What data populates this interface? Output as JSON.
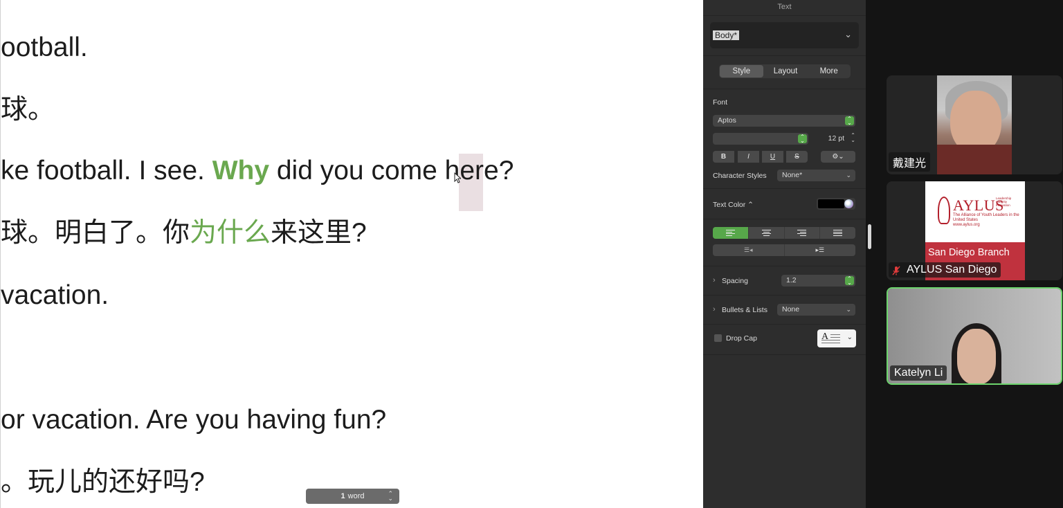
{
  "document": {
    "lines": [
      {
        "segments": [
          {
            "text": "ootball.",
            "style": "normal"
          }
        ]
      },
      {
        "segments": [
          {
            "text": "球。",
            "style": "normal"
          }
        ]
      },
      {
        "segments": [
          {
            "text": "ke football. I see. ",
            "style": "normal"
          },
          {
            "text": "Why",
            "style": "highlight-bold"
          },
          {
            "text": " did you come here?",
            "style": "normal"
          }
        ]
      },
      {
        "segments": [
          {
            "text": "球。明白了。你",
            "style": "normal"
          },
          {
            "text": "为什么",
            "style": "highlight"
          },
          {
            "text": "来这里?",
            "style": "normal"
          }
        ]
      },
      {
        "segments": [
          {
            "text": "vacation.",
            "style": "normal"
          }
        ]
      },
      {
        "segments": [
          {
            "text": "or vacation. Are you having fun?",
            "style": "normal"
          }
        ]
      },
      {
        "segments": [
          {
            "text": "。玩儿的还好吗?",
            "style": "normal"
          }
        ]
      }
    ],
    "highlight_color": "#6aa84f",
    "word_count": {
      "number": "1",
      "unit": "word"
    }
  },
  "inspector": {
    "title": "Text",
    "paragraph_style": "Body*",
    "tabs": [
      {
        "label": "Style",
        "active": true
      },
      {
        "label": "Layout",
        "active": false
      },
      {
        "label": "More",
        "active": false
      }
    ],
    "font_section_label": "Font",
    "font_name": "Aptos",
    "font_typeface": "",
    "font_size": "12 pt",
    "format_buttons": [
      "B",
      "I",
      "U",
      "S"
    ],
    "character_styles_label": "Character Styles",
    "character_styles_value": "None*",
    "text_color_label": "Text Color ⌃",
    "text_color": "#000000",
    "alignment_active": "left",
    "spacing_label": "Spacing",
    "spacing_value": "1.2",
    "bullets_label": "Bullets & Lists",
    "bullets_value": "None",
    "drop_cap_label": "Drop Cap",
    "accent_color": "#57a84a"
  },
  "participants": [
    {
      "name": "戴建光",
      "muted": false,
      "speaking": false
    },
    {
      "name": "AYLUS San Diego",
      "muted": true,
      "speaking": false,
      "card": {
        "logo": "AYLUS",
        "tagline": [
          "Leadership",
          "Integrity",
          "Innovation"
        ],
        "subtitle": "The Alliance of Youth Leaders in the United States",
        "url": "www.aylus.org",
        "branch": "San Diego Branch"
      }
    },
    {
      "name": "Katelyn Li",
      "muted": false,
      "speaking": true
    }
  ]
}
